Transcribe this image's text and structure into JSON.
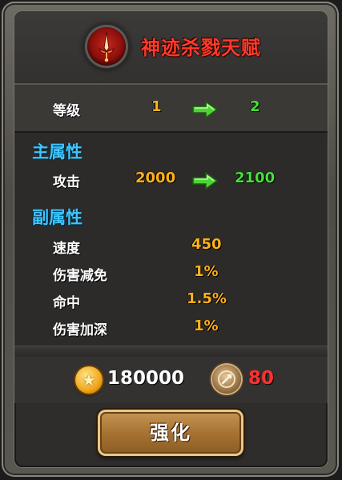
{
  "header": {
    "title": "神迹杀戮天赋",
    "emblem_icon": "sword-emblem-icon"
  },
  "level": {
    "label": "等级",
    "current": "1",
    "next": "2"
  },
  "main_attrs": {
    "title": "主属性",
    "items": [
      {
        "label": "攻击",
        "current": "2000",
        "next": "2100"
      }
    ]
  },
  "sub_attrs": {
    "title": "副属性",
    "items": [
      {
        "label": "速度",
        "value": "450"
      },
      {
        "label": "伤害减免",
        "value": "1%"
      },
      {
        "label": "命中",
        "value": "1.5%"
      },
      {
        "label": "伤害加深",
        "value": "1%"
      }
    ]
  },
  "cost": {
    "gold": "180000",
    "gold_icon": "gold-coin-icon",
    "stone": "80",
    "stone_icon": "upgrade-stone-icon"
  },
  "action": {
    "button_label": "强化"
  },
  "colors": {
    "title": "#ff3a2a",
    "section": "#3ec6ff",
    "current": "#ffb21a",
    "next": "#46e03a",
    "stone_count": "#ff3030"
  }
}
